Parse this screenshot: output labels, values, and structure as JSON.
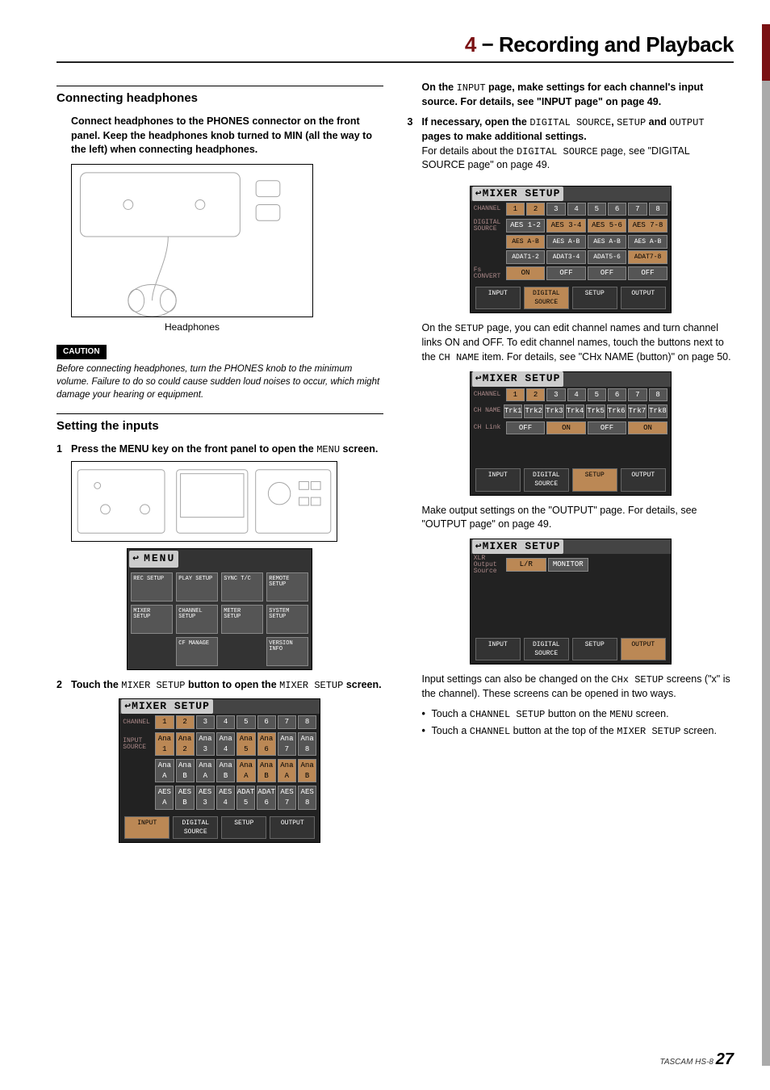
{
  "chapter": {
    "num": "4",
    "sep": " − ",
    "title": "Recording and Playback"
  },
  "left": {
    "h_headphones": "Connecting headphones",
    "headphones_para": "Connect headphones to the PHONES connector on the front panel. Keep the headphones knob turned to MIN (all the way to the left) when connecting headphones.",
    "hp_label": "Headphones",
    "caution_label": "CAUTION",
    "caution_text": "Before connecting headphones, turn the PHONES knob to the minimum volume. Failure to do so could cause sudden loud noises to occur, which might damage your hearing or equipment.",
    "h_inputs": "Setting the inputs",
    "step1_a": "Press the ",
    "step1_b": "MENU",
    "step1_c": " key on the front panel to open the ",
    "step1_code": "MENU",
    "step1_d": " screen.",
    "step2_a": "Touch the ",
    "step2_code1": "MIXER SETUP",
    "step2_b": " button to open the ",
    "step2_code2": "MIXER SETUP",
    "step2_c": " screen.",
    "menu": {
      "title": "MENU",
      "items": [
        "REC SETUP",
        "PLAY SETUP",
        "SYNC T/C",
        "REMOTE SETUP",
        "MIXER SETUP",
        "CHANNEL SETUP",
        "METER SETUP",
        "SYSTEM SETUP",
        "",
        "CF MANAGE",
        "",
        "VERSION INFO"
      ]
    },
    "mixer_input": {
      "title": "MIXER SETUP",
      "label_channel": "CHANNEL",
      "channels": [
        "1",
        "2",
        "3",
        "4",
        "5",
        "6",
        "7",
        "8"
      ],
      "label_source": "INPUT SOURCE",
      "row1": [
        "Ana 1",
        "Ana 2",
        "Ana 3",
        "Ana 4",
        "Ana 5",
        "Ana 6",
        "Ana 7",
        "Ana 8"
      ],
      "row2": [
        "Ana A",
        "Ana B",
        "Ana A",
        "Ana B",
        "Ana A",
        "Ana B",
        "Ana A",
        "Ana B"
      ],
      "row3": [
        "AES A",
        "AES B",
        "AES 3",
        "AES 4",
        "ADAT 5",
        "ADAT 6",
        "AES 7",
        "AES 8"
      ],
      "tabs": [
        "INPUT",
        "DIGITAL SOURCE",
        "SETUP",
        "OUTPUT"
      ]
    }
  },
  "right": {
    "intro_a": "On the ",
    "intro_code": "INPUT",
    "intro_b": " page, make settings for each channel's input source. For details, see \"INPUT page\" on page 49.",
    "step3_a": "If necessary, open the ",
    "step3_c1": "DIGITAL SOURCE",
    "step3_b": ", ",
    "step3_c2": "SETUP",
    "step3_c": " and ",
    "step3_c3": "OUTPUT",
    "step3_d": " pages to make additional settings.",
    "step3_sub_a": "For details about the ",
    "step3_sub_code": "DIGITAL SOURCE",
    "step3_sub_b": " page, see \"DIGITAL SOURCE page\" on page 49.",
    "mixer_digital": {
      "title": "MIXER SETUP",
      "label_channel": "CHANNEL",
      "channels": [
        "1",
        "2",
        "3",
        "4",
        "5",
        "6",
        "7",
        "8"
      ],
      "label_src": "DIGITAL SOURCE",
      "r1": [
        "AES 1-2",
        "AES 3-4",
        "AES 5-6",
        "AES 7-8"
      ],
      "r2": [
        "AES A-B",
        "AES A-B",
        "AES A-B",
        "AES A-B"
      ],
      "r3": [
        "ADAT1-2",
        "ADAT3-4",
        "ADAT5-6",
        "ADAT7-8"
      ],
      "label_fs": "Fs CONVERT",
      "fs": [
        "ON",
        "OFF",
        "OFF",
        "OFF"
      ],
      "tabs": [
        "INPUT",
        "DIGITAL SOURCE",
        "SETUP",
        "OUTPUT"
      ]
    },
    "setup_para_a": "On the ",
    "setup_para_code": "SETUP",
    "setup_para_b": " page, you can edit channel names and turn channel links ON and OFF. To edit channel names, touch the buttons next to the ",
    "setup_para_code2": "CH NAME",
    "setup_para_c": " item. For details, see \"CHx NAME (button)\" on page 50.",
    "mixer_setup": {
      "title": "MIXER SETUP",
      "label_channel": "CHANNEL",
      "channels": [
        "1",
        "2",
        "3",
        "4",
        "5",
        "6",
        "7",
        "8"
      ],
      "label_name": "CH NAME",
      "names": [
        "Trk1",
        "Trk2",
        "Trk3",
        "Trk4",
        "Trk5",
        "Trk6",
        "Trk7",
        "Trk8"
      ],
      "label_link": "CH Link",
      "links": [
        "OFF",
        "ON",
        "OFF",
        "ON"
      ],
      "tabs": [
        "INPUT",
        "DIGITAL SOURCE",
        "SETUP",
        "OUTPUT"
      ]
    },
    "output_para": "Make output settings on the \"OUTPUT\" page. For details, see \"OUTPUT page\" on page 49.",
    "mixer_output": {
      "title": "MIXER SETUP",
      "label": "XLR Output Source",
      "opts": [
        "L/R",
        "MONITOR"
      ],
      "tabs": [
        "INPUT",
        "DIGITAL SOURCE",
        "SETUP",
        "OUTPUT"
      ]
    },
    "tail_a": "Input settings can also be changed on the ",
    "tail_code": "CHx SETUP",
    "tail_b": " screens (\"x\" is the channel). These screens can be opened in two ways.",
    "bullet1_a": "Touch a ",
    "bullet1_code": "CHANNEL SETUP",
    "bullet1_b": " button on the ",
    "bullet1_code2": "MENU",
    "bullet1_c": " screen.",
    "bullet2_a": "Touch a ",
    "bullet2_code": "CHANNEL",
    "bullet2_b": " button at the top of the ",
    "bullet2_code2": "MIXER SETUP",
    "bullet2_c": " screen."
  },
  "footer": {
    "brand": "TASCAM  HS-8",
    "page": "27"
  }
}
